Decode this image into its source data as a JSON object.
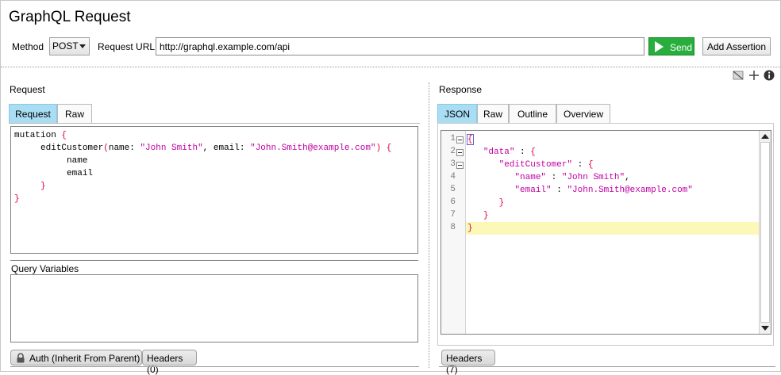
{
  "app": {
    "title": "GraphQL Request"
  },
  "toolbar": {
    "method_label": "Method",
    "method_value": "POST",
    "url_label": "Request URL:",
    "url_value": "http://graphql.example.com/api",
    "send_label": "Send",
    "add_assertion_label": "Add Assertion"
  },
  "request": {
    "section_title": "Request",
    "tabs": [
      {
        "label": "Request",
        "active": true
      },
      {
        "label": "Raw",
        "active": false
      }
    ],
    "code": [
      "mutation {",
      "    editCustomer(name: \"John Smith\", email: \"John.Smith@example.com\") {",
      "        name",
      "        email",
      "    }",
      "}"
    ],
    "mutation_kw": "mutation",
    "field": "editCustomer",
    "arg1_name": "name: ",
    "arg1_value": "\"John Smith\"",
    "arg2_name": ", email: ",
    "arg2_value": "\"John.Smith@example.com\"",
    "sel1": "name",
    "sel2": "email",
    "query_variables_label": "Query Variables"
  },
  "response": {
    "section_title": "Response",
    "tabs": [
      {
        "label": "JSON",
        "active": true
      },
      {
        "label": "Raw",
        "active": false
      },
      {
        "label": "Outline",
        "active": false
      },
      {
        "label": "Overview",
        "active": false
      }
    ],
    "lines": [
      {
        "n": "1",
        "fold": true
      },
      {
        "n": "2",
        "fold": true
      },
      {
        "n": "3",
        "fold": true
      },
      {
        "n": "4",
        "fold": false
      },
      {
        "n": "5",
        "fold": false
      },
      {
        "n": "6",
        "fold": false
      },
      {
        "n": "7",
        "fold": false
      },
      {
        "n": "8",
        "fold": false
      }
    ],
    "json": {
      "k_data": "\"data\"",
      "k_edit": "\"editCustomer\"",
      "k_name": "\"name\"",
      "v_name": "\"John Smith\"",
      "k_email": "\"email\"",
      "v_email": "\"John.Smith@example.com\""
    }
  },
  "bottom": {
    "auth_label": "Auth (Inherit From Parent)",
    "req_headers_label": "Headers (0)",
    "resp_headers_label": "Headers (7)"
  },
  "colors": {
    "accent_tab": "#a9ddf3",
    "send_green": "#27ae3c",
    "string": "#c000a0",
    "brace": "#e0003c",
    "highlight": "#fbf8b8"
  }
}
